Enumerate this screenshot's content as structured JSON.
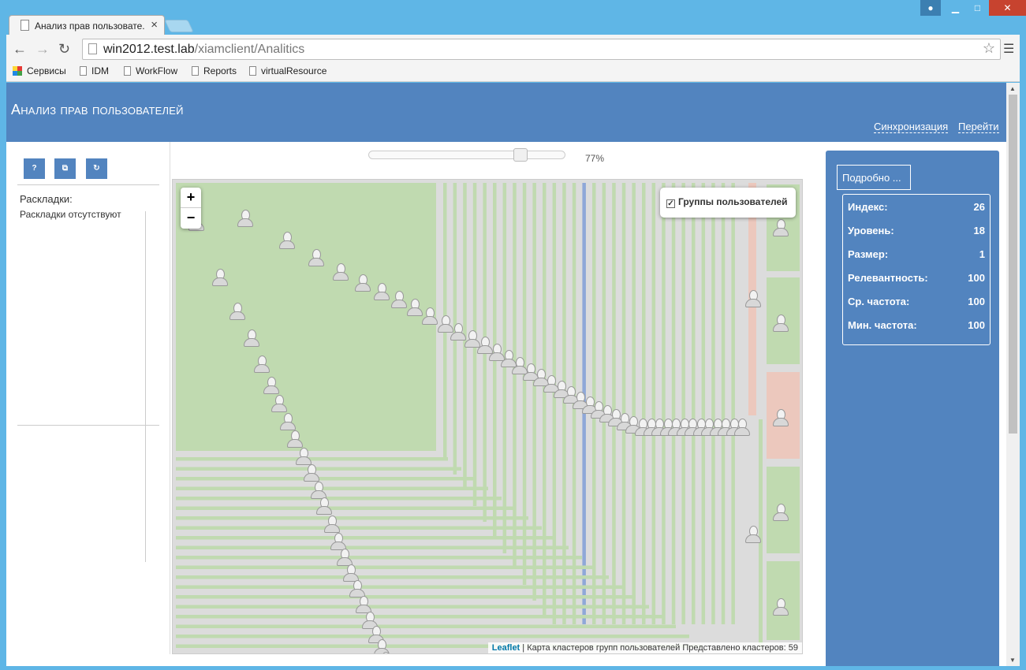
{
  "browser": {
    "tab_title": "Анализ прав пользовате.",
    "url_host": "win2012.test.lab",
    "url_path": "/xiamclient/Analitics",
    "bookmarks": [
      "Сервисы",
      "IDM",
      "WorkFlow",
      "Reports",
      "virtualResource"
    ]
  },
  "header": {
    "title": "Анализ прав пользователей",
    "links": [
      "Синхронизация",
      "Перейти"
    ]
  },
  "left": {
    "buttons": [
      "?",
      "⧉",
      "↻"
    ],
    "layouts_label": "Раскладки:",
    "layouts_empty": "Раскладки отсутствуют"
  },
  "slider": {
    "value": 0.77,
    "label": "77%"
  },
  "map": {
    "zoom_in": "+",
    "zoom_out": "−",
    "layer_label": "Группы пользователей",
    "layer_checked": true,
    "attribution_link": "Leaflet",
    "attribution_text": " | Карта кластеров групп пользователей Представлено кластеров: 59"
  },
  "details": {
    "button": "Подробно ...",
    "rows": [
      {
        "label": "Индекс:",
        "value": "26"
      },
      {
        "label": "Уровень:",
        "value": "18"
      },
      {
        "label": "Размер:",
        "value": "1"
      },
      {
        "label": "Релевантность:",
        "value": "100"
      },
      {
        "label": "Ср. частота:",
        "value": "100"
      },
      {
        "label": "Мин. частота:",
        "value": "100"
      }
    ]
  },
  "colors": {
    "header": "#5284bf",
    "cluster_green": "#c0dab0",
    "cluster_red": "#ecc8bd",
    "highlight_line": "#8fa8d8"
  }
}
